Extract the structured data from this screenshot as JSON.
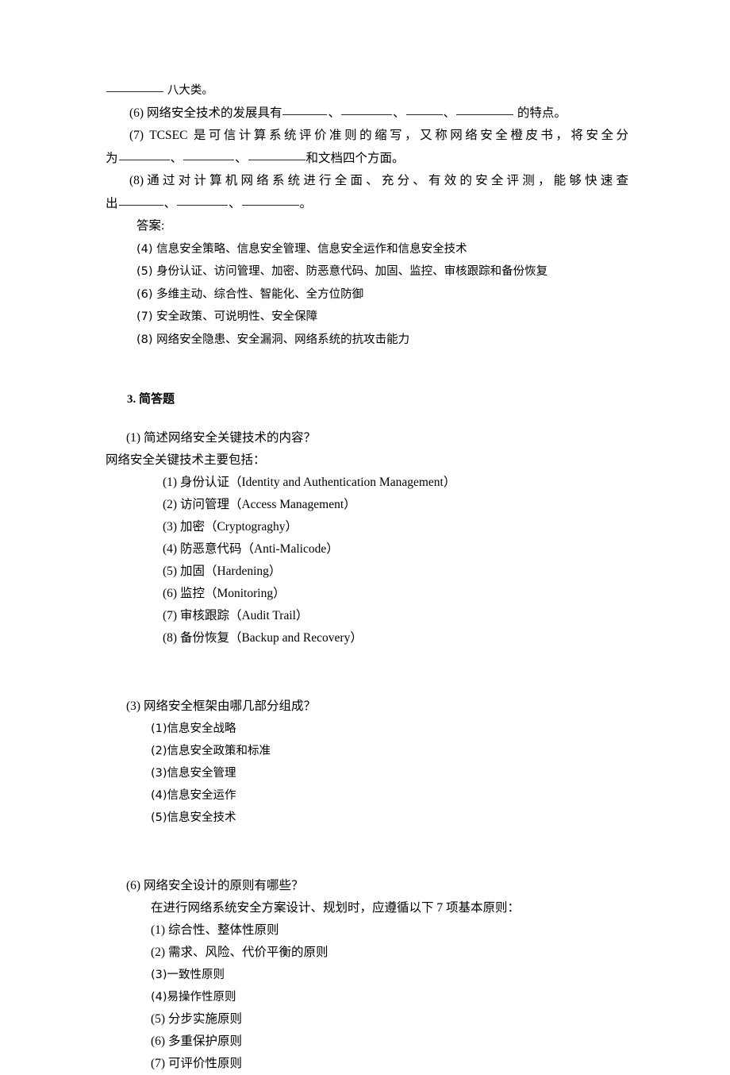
{
  "document": {
    "fill_in_blanks": {
      "top_fragment": {
        "blank": "________",
        "text": "八大类。"
      },
      "items": [
        {
          "num": "(6)",
          "parts": [
            "网络安全技术的发展具有",
            "、",
            "、",
            "、",
            "的特点。"
          ],
          "text": "(6) 网络安全技术的发展具有________、________、________、________的特点。"
        },
        {
          "num": "(7)",
          "text": "(7) TCSEC 是可信计算系统评价准则的缩写，又称网络安全橙皮书，将安全分为________、________、________和文档四个方面。",
          "line1": "(7) TCSEC 是可信计算系统评价准则的缩写，又称网络安全橙皮书，将安全分",
          "line2_lead": "为",
          "line2_tail": "和文档四个方面。"
        },
        {
          "num": "(8)",
          "text": "(8)通过对计算机网络系统进行全面、充分、有效的安全评测，能够快速查出________、________、________。",
          "line1": "(8)通过对计算机网络系统进行全面、充分、有效的安全评测，能够快速查",
          "line2_lead": "出",
          "line2_tail": "。"
        }
      ]
    },
    "answers": {
      "label": "答案:",
      "items": [
        {
          "num": "(4)",
          "text": "信息安全策略、信息安全管理、信息安全运作和信息安全技术"
        },
        {
          "num": "(5)",
          "text": "身份认证、访问管理、加密、防恶意代码、加固、监控、审核跟踪和备份恢复"
        },
        {
          "num": "(6)",
          "text": "多维主动、综合性、智能化、全方位防御"
        },
        {
          "num": "(7)",
          "text": "安全政策、可说明性、安全保障"
        },
        {
          "num": "(8)",
          "text": "网络安全隐患、安全漏洞、网络系统的抗攻击能力"
        }
      ]
    },
    "section3": {
      "heading": "3. 简答题",
      "questions": [
        {
          "id": "q1",
          "title": "(1) 简述网络安全关键技术的内容？",
          "intro": "网络安全关键技术主要包括：",
          "items": [
            {
              "num": "(1)",
              "text": "身份认证（Identity and Authentication Management）"
            },
            {
              "num": "(2)",
              "text": "访问管理（Access Management）"
            },
            {
              "num": "(3)",
              "text": "加密（Cryptograghy）"
            },
            {
              "num": "(4)",
              "text": "防恶意代码（Anti-Malicode）"
            },
            {
              "num": "(5)",
              "text": "加固（Hardening）"
            },
            {
              "num": "(6)",
              "text": "监控（Monitoring）"
            },
            {
              "num": "(7)",
              "text": "审核跟踪（Audit Trail）"
            },
            {
              "num": "(8)",
              "text": "备份恢复（Backup and Recovery）"
            }
          ]
        },
        {
          "id": "q3",
          "title": "(3) 网络安全框架由哪几部分组成？",
          "items": [
            {
              "num": "(1)",
              "text": "信息安全战略"
            },
            {
              "num": "(2)",
              "text": "信息安全政策和标准"
            },
            {
              "num": "(3)",
              "text": "信息安全管理"
            },
            {
              "num": "(4)",
              "text": "信息安全运作"
            },
            {
              "num": "(5)",
              "text": "信息安全技术"
            }
          ]
        },
        {
          "id": "q6",
          "title": "(6) 网络安全设计的原则有哪些？",
          "intro": "在进行网络系统安全方案设计、规划时，应遵循以下 7 项基本原则：",
          "items": [
            {
              "num": "(1)",
              "text": "综合性、整体性原则"
            },
            {
              "num": "(2)",
              "text": "需求、风险、代价平衡的原则"
            },
            {
              "num": "(3)",
              "text": "一致性原则"
            },
            {
              "num": "(4)",
              "text": "易操作性原则"
            },
            {
              "num": "(5)",
              "text": "分步实施原则"
            },
            {
              "num": "(6)",
              "text": "多重保护原则"
            },
            {
              "num": "(7)",
              "text": "可评价性原则"
            }
          ]
        }
      ]
    }
  }
}
